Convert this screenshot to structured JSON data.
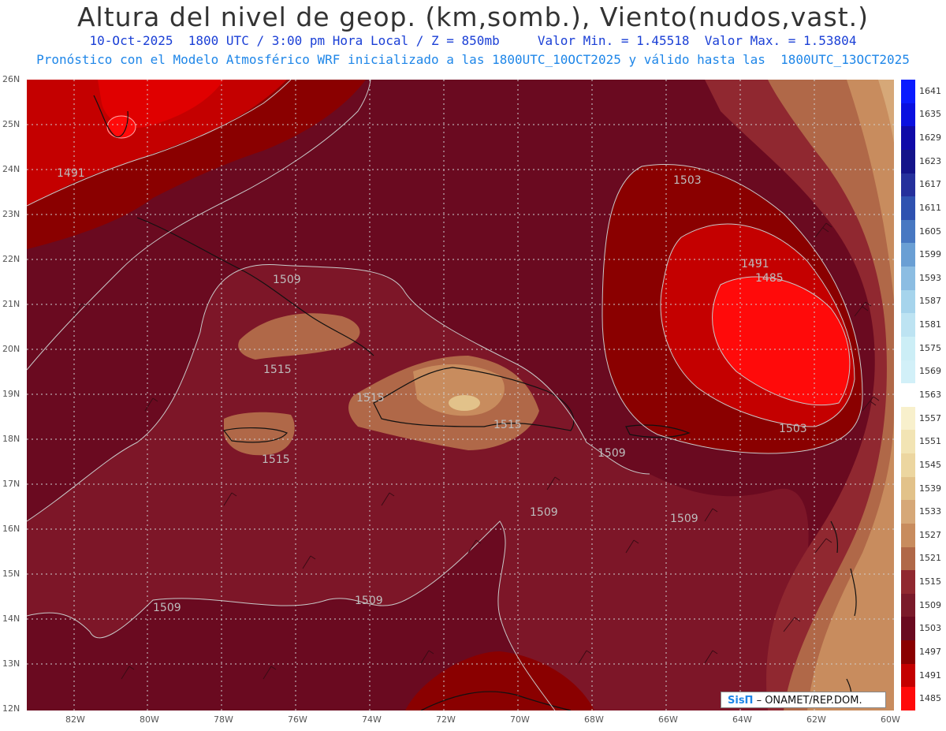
{
  "header": {
    "title": "Altura del nivel de geop. (km,somb.), Viento(nudos,vast.)",
    "line1": "10-Oct-2025  1800 UTC / 3:00 pm Hora Local / Z = 850mb     Valor Min. = 1.45518  Valor Max. = 1.53804",
    "line2": "Pronóstico con el Modelo Atmosférico WRF inicializado a las 1800UTC_10OCT2025 y válido hasta las  1800UTC_13OCT2025"
  },
  "axes": {
    "lat_labels": [
      "26N",
      "25N",
      "24N",
      "23N",
      "22N",
      "21N",
      "20N",
      "19N",
      "18N",
      "17N",
      "16N",
      "15N",
      "14N",
      "13N",
      "12N"
    ],
    "lon_labels": [
      "82W",
      "80W",
      "78W",
      "76W",
      "74W",
      "72W",
      "70W",
      "68W",
      "66W",
      "64W",
      "62W",
      "60W"
    ]
  },
  "contour_labels": [
    "1491",
    "1503",
    "1491",
    "1485",
    "1509",
    "1515",
    "1515",
    "1515",
    "1515",
    "1503",
    "1509",
    "1509",
    "1509",
    "1509",
    "1509"
  ],
  "colorbar": {
    "labels": [
      "1641",
      "1635",
      "1629",
      "1623",
      "1617",
      "1611",
      "1605",
      "1599",
      "1593",
      "1587",
      "1581",
      "1575",
      "1569",
      "1563",
      "1557",
      "1551",
      "1545",
      "1539",
      "1533",
      "1527",
      "1521",
      "1515",
      "1509",
      "1503",
      "1497",
      "1491",
      "1485"
    ],
    "colors": [
      "#0a1bff",
      "#0a10e0",
      "#0f0aa8",
      "#14148a",
      "#25309c",
      "#2f52b0",
      "#4878c2",
      "#6a9fd4",
      "#8cbde2",
      "#a6d4ec",
      "#bde3f2",
      "#cceef6",
      "#d2f0f8",
      "#ffffff",
      "#f8f0cc",
      "#f2e4b4",
      "#ecd6a0",
      "#e2c28a",
      "#d6a878",
      "#c88c5e",
      "#b06848",
      "#902830",
      "#7a1a2a",
      "#6a0a20",
      "#8a0000",
      "#c40000",
      "#ff0a0a"
    ]
  },
  "credit": {
    "brand": "SisΠ",
    "text": " – ONAMET/REP.DOM."
  }
}
